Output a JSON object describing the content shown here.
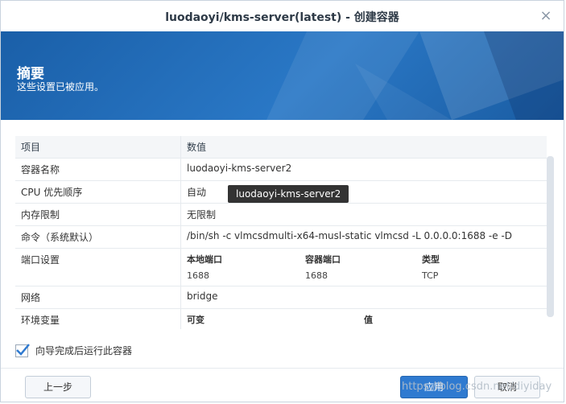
{
  "window": {
    "title": "luodaoyi/kms-server(latest) - 创建容器",
    "close_glyph": "×"
  },
  "banner": {
    "heading": "摘要",
    "subtitle": "这些设置已被应用。"
  },
  "table": {
    "header": {
      "key": "项目",
      "value": "数值"
    },
    "rows": [
      {
        "key": "容器名称",
        "value": "luodaoyi-kms-server2"
      },
      {
        "key": "CPU 优先顺序",
        "value": "自动"
      },
      {
        "key": "内存限制",
        "value": "无限制"
      },
      {
        "key": "命令（系统默认）",
        "value": "/bin/sh -c vlmcsdmulti-x64-musl-static vlmcsd -L 0.0.0.0:1688 -e -D"
      },
      {
        "key": "端口设置",
        "value": ""
      },
      {
        "key": "网络",
        "value": "bridge"
      },
      {
        "key": "环境变量",
        "value": ""
      }
    ],
    "ports": {
      "headers": [
        "本地端口",
        "容器端口",
        "类型"
      ],
      "values": [
        "1688",
        "1688",
        "TCP"
      ]
    },
    "env": {
      "headers": [
        "可变",
        "值"
      ]
    }
  },
  "tooltip": "luodaoyi-kms-server2",
  "checkbox": {
    "label": "向导完成后运行此容器",
    "checked": true
  },
  "buttons": {
    "back": "上一步",
    "apply": "应用",
    "cancel": "取消"
  },
  "watermark": "https://blog.csdn.net/diyiday",
  "colors": {
    "accent": "#2f7ad0",
    "banner": "#1f68b5"
  }
}
